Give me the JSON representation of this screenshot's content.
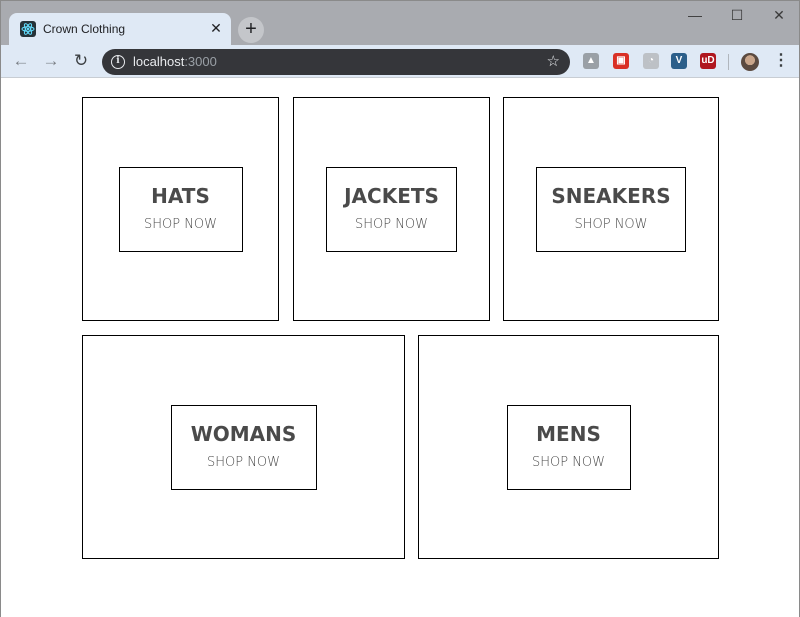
{
  "browser": {
    "tab_title": "Crown Clothing",
    "tab_close": "✕",
    "new_tab": "+",
    "url_host": "localhost",
    "url_port": ":3000",
    "window_controls": {
      "minimize": "—",
      "maximize": "☐",
      "close": "✕"
    },
    "nav": {
      "back": "←",
      "forward": "→",
      "reload": "↻"
    },
    "star": "☆",
    "menu": "⋮",
    "info": "i",
    "extensions": [
      {
        "name": "google-drive-icon",
        "glyph": "▲",
        "color": "#9aa0a6"
      },
      {
        "name": "red-extension-icon",
        "glyph": "▣",
        "color": "#d93025"
      },
      {
        "name": "ghost-extension-icon",
        "glyph": "◔",
        "color": "#bdc1c6"
      },
      {
        "name": "vue-devtools-icon",
        "glyph": "V",
        "color": "#2c5f8a"
      },
      {
        "name": "ublock-icon",
        "glyph": "uD",
        "color": "#b0171f"
      }
    ]
  },
  "directory": {
    "items": [
      {
        "title": "HATS",
        "subtitle": "SHOP NOW"
      },
      {
        "title": "JACKETS",
        "subtitle": "SHOP NOW"
      },
      {
        "title": "SNEAKERS",
        "subtitle": "SHOP NOW"
      },
      {
        "title": "WOMANS",
        "subtitle": "SHOP NOW"
      },
      {
        "title": "MENS",
        "subtitle": "SHOP NOW"
      }
    ]
  }
}
